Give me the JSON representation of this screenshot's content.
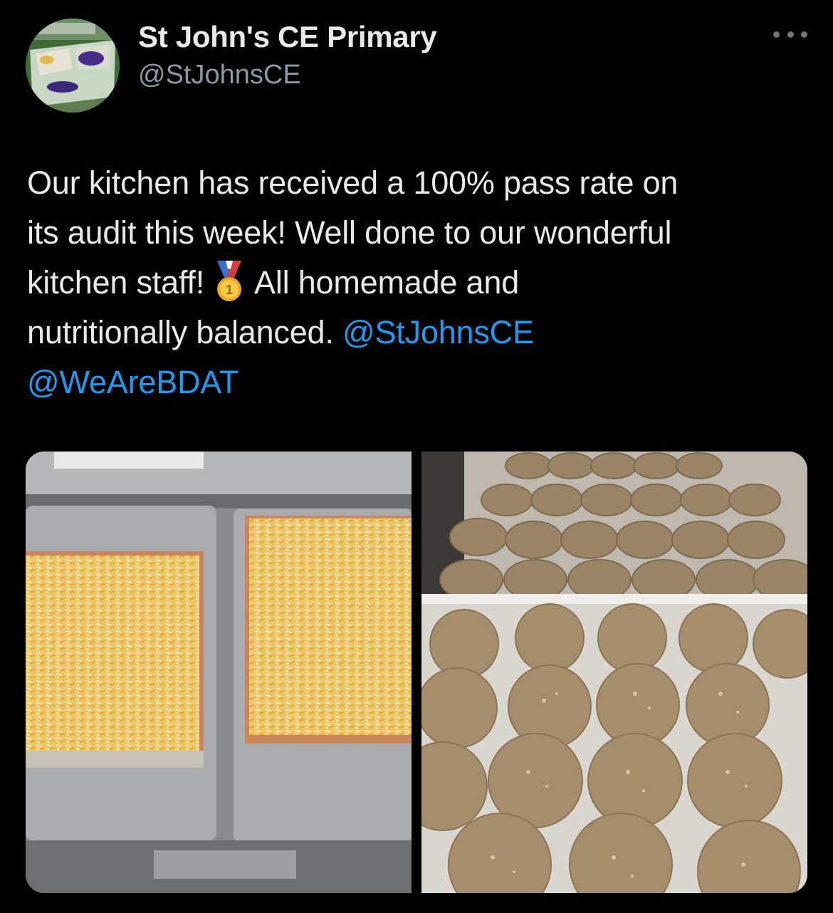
{
  "tweet": {
    "author": {
      "display_name": "St John's CE Primary",
      "handle": "@StJohnsCE",
      "avatar_icon": "school-logo-avatar"
    },
    "more_icon": "more-horizontal-icon",
    "text_lines": {
      "line1": "Our kitchen has received a 100% pass rate on",
      "line2": "its audit this week! Well done to our wonderful",
      "line3_before": "kitchen staff!",
      "line3_emoji": "first-place-medal-icon",
      "line3_after": "All homemade and",
      "line4_before": "nutritionally balanced.",
      "mention1": "@StJohnsCE",
      "mention2": "@WeAreBDAT"
    },
    "media": [
      {
        "subject": "pizza-trays-photo"
      },
      {
        "subject": "muffins-photo"
      }
    ]
  },
  "colors": {
    "background": "#000000",
    "text": "#e7e9ea",
    "secondary_text": "#8b98a5",
    "link": "#1d9bf0"
  }
}
